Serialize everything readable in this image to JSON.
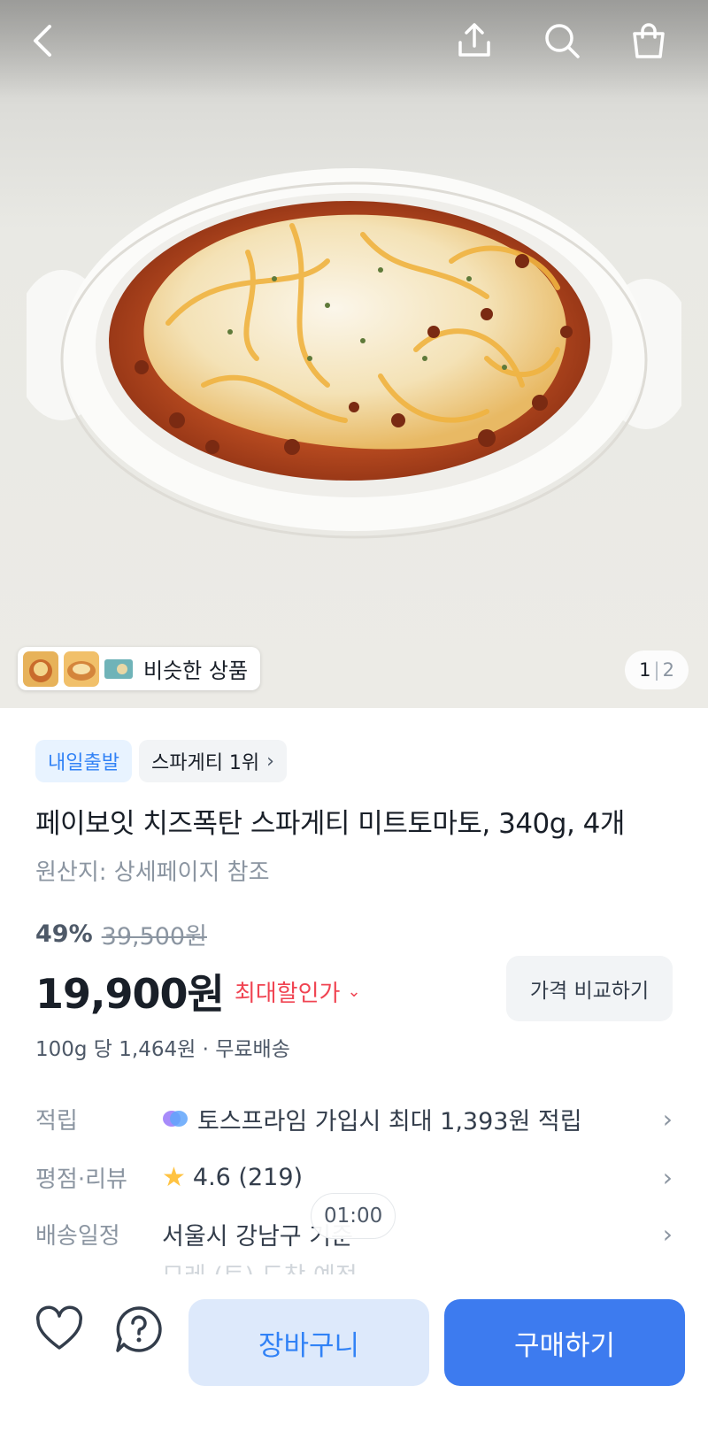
{
  "header": {
    "icons": {
      "back": "back-icon",
      "share": "share-icon",
      "search": "search-icon",
      "cart": "shopping-bag-icon"
    }
  },
  "gallery": {
    "similar_label": "비슷한 상품",
    "page_current": "1",
    "page_separator": "|",
    "page_total": "2"
  },
  "product": {
    "badges": [
      "내일출발",
      "스파게티 1위"
    ],
    "title": "페이보잇 치즈폭탄 스파게티 미트토마토, 340g, 4개",
    "origin": "원산지: 상세페이지 참조",
    "discount_rate": "49%",
    "original_price": "39,500원",
    "price": "19,900원",
    "max_discount_label": "최대할인가",
    "compare_label": "가격 비교하기",
    "unit_price": "100g 당 1,464원 · 무료배송"
  },
  "info_rows": [
    {
      "key": "적립",
      "value": "토스프라임 가입시 최대 1,393원 적립"
    },
    {
      "key": "평점·리뷰",
      "value": "4.6 (219)"
    },
    {
      "key": "배송일정",
      "value": "서울시 강남구 기준"
    }
  ],
  "delivery_faded": "모레 (토) 도착 예정",
  "timer": "01:00",
  "bottom": {
    "cart_label": "장바구니",
    "buy_label": "구매하기"
  },
  "colors": {
    "accent": "#3182f6",
    "buy_button": "#3d7bef",
    "discount_red": "#f04452",
    "star": "#ffc342"
  }
}
